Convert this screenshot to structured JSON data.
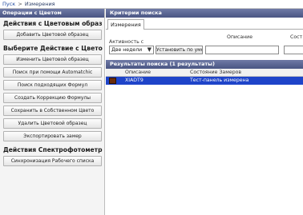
{
  "breadcrumb": {
    "link": "Пуск",
    "separator": ">",
    "current": "Измерения"
  },
  "left_panel": {
    "header": "Операции с Цветом",
    "section1_title": "Действия с Цветовым образ",
    "section1_buttons": [
      "Добавить Цветовой образец"
    ],
    "section2_title": "Выберите Действие с Цвето",
    "section2_buttons": [
      "Изменить Цветовой образец",
      "Поиск при помощи Automatchic",
      "Поиск подходящих Формул",
      "Создать Коррекцию Формулы",
      "Сохранить в Собственном Цвето",
      "Удалить Цветовой образец",
      "Экспортировать замер"
    ],
    "section3_title": "Действия Спектрофотометр",
    "section3_buttons": [
      "Синхронизация Рабочего списка"
    ]
  },
  "criteria": {
    "header": "Критерии поиска",
    "tab": "Измерения",
    "activity_label": "Активность с",
    "activity_value": "Две недели",
    "default_button": "Установить по умол",
    "description_label": "Описание",
    "composition_label": "Сост"
  },
  "results": {
    "header": "Результаты поиска",
    "count": "(1 результаты)",
    "columns": [
      "Описание",
      "Состояние Замеров"
    ],
    "rows": [
      {
        "description": "XIADT9",
        "status": "Тест-панель измерена"
      }
    ]
  },
  "colors": {
    "header_bg": "#5a6592",
    "selected_row": "#1e44c9",
    "swatch": "#6b2d0c"
  }
}
